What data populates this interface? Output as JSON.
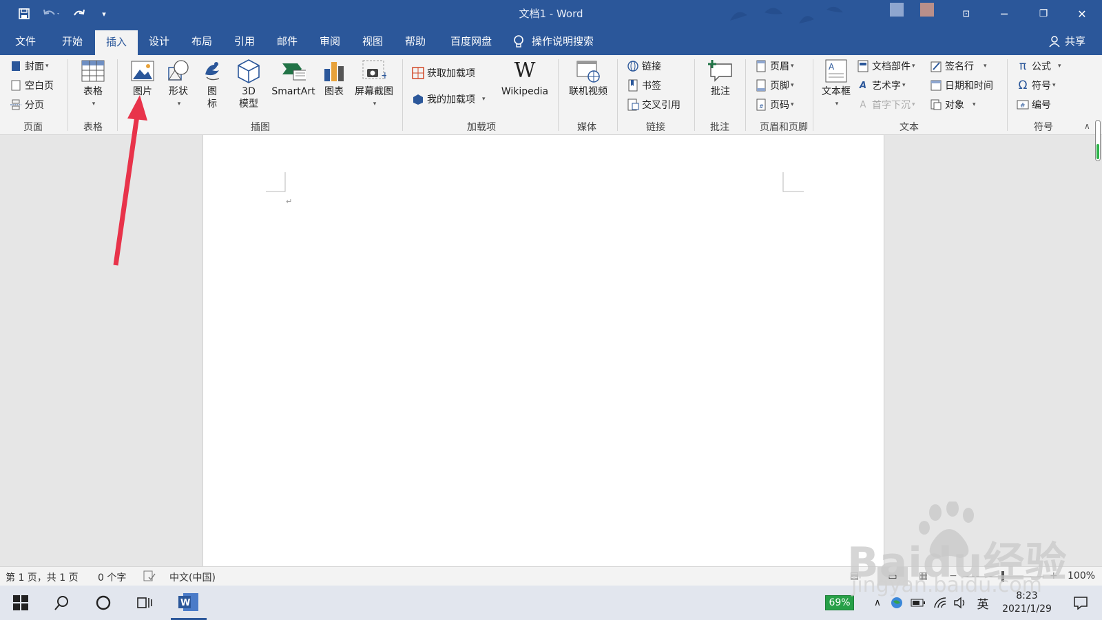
{
  "app": {
    "title": "文档1  -  Word",
    "share_label": "共享",
    "search_label": "操作说明搜索"
  },
  "menu": {
    "tabs": [
      "文件",
      "开始",
      "插入",
      "设计",
      "布局",
      "引用",
      "邮件",
      "审阅",
      "视图",
      "帮助",
      "百度网盘"
    ],
    "active_index": 2
  },
  "ribbon": {
    "page_group": {
      "label": "页面",
      "items": [
        "封面",
        "空白页",
        "分页"
      ]
    },
    "table_group": {
      "label": "表格",
      "button": "表格"
    },
    "illustrations": {
      "label": "插图",
      "picture": "图片",
      "shapes": "形状",
      "icons": "图\n标",
      "model3d": "3D\n模型",
      "smartart": "SmartArt",
      "chart": "图表",
      "screenshot": "屏幕截图"
    },
    "addins": {
      "label": "加载项",
      "get": "获取加载项",
      "mine": "我的加载项",
      "wiki": "Wikipedia"
    },
    "media": {
      "label": "媒体",
      "video": "联机视频"
    },
    "links": {
      "label": "链接",
      "link": "链接",
      "bookmark": "书签",
      "crossref": "交叉引用"
    },
    "comments": {
      "label": "批注",
      "comment": "批注"
    },
    "headerfooter": {
      "label": "页眉和页脚",
      "header": "页眉",
      "footer": "页脚",
      "pagenum": "页码"
    },
    "text": {
      "label": "文本",
      "textbox": "文本框",
      "parts": "文档部件",
      "wordart": "艺术字",
      "dropcap": "首字下沉",
      "sigline": "签名行",
      "datetime": "日期和时间",
      "object": "对象"
    },
    "symbols": {
      "label": "符号",
      "equation": "公式",
      "symbol": "符号",
      "number": "编号"
    }
  },
  "status": {
    "page": "第 1 页，共 1 页",
    "words": "0 个字",
    "lang": "中文(中国)",
    "zoom": "100%"
  },
  "taskbar": {
    "battery_pct": "69%",
    "ime": "英",
    "time": "8:23",
    "date": "2021/1/29"
  },
  "watermark": {
    "text": "Baidu经验",
    "url": "jingyan.baidu.com"
  },
  "colors": {
    "word_blue": "#2b579a",
    "arrow": "#e8334a"
  }
}
